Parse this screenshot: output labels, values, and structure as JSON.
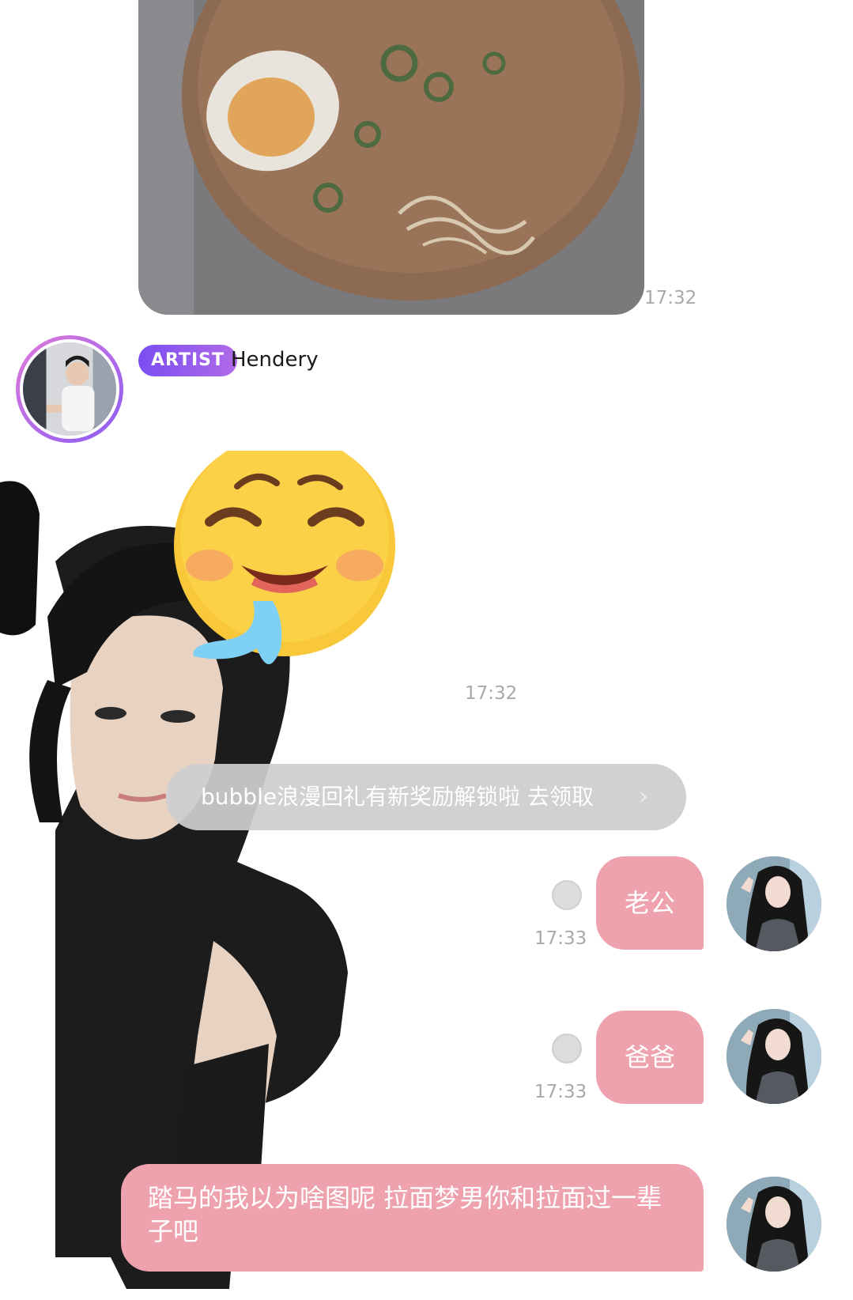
{
  "messages": {
    "photo": {
      "alt_icon": "ramen-photo",
      "time": "17:32"
    },
    "artist": {
      "badge": "ARTIST",
      "name": "Hendery"
    },
    "sticker": {
      "icon": "drooling-face-sticker",
      "time": "17:32"
    },
    "notice": {
      "text": "bubble浪漫回礼有新奖励解锁啦 去领取",
      "chevron": "›"
    },
    "outgoing": [
      {
        "text": "老公",
        "time": "17:33"
      },
      {
        "text": "爸爸",
        "time": "17:33"
      },
      {
        "text": "踏马的我以为啥图呢 拉面梦男你和拉面过一辈子吧"
      }
    ]
  }
}
